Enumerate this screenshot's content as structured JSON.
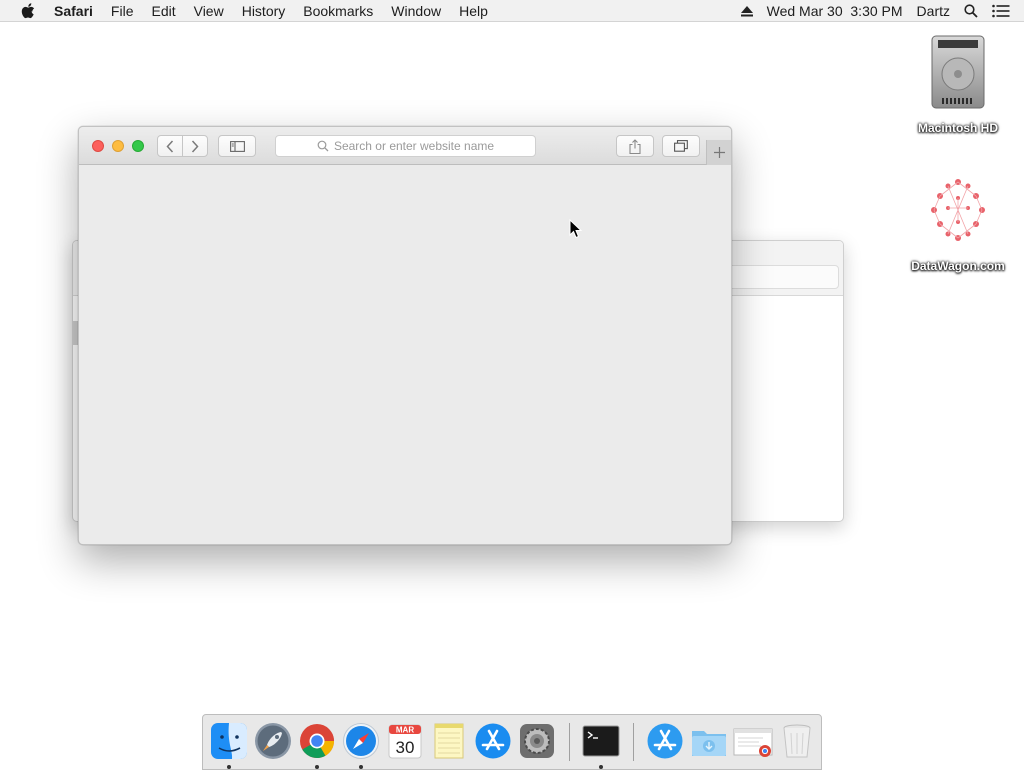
{
  "menubar": {
    "app_name": "Safari",
    "items": [
      "File",
      "Edit",
      "View",
      "History",
      "Bookmarks",
      "Window",
      "Help"
    ],
    "datetime": "Wed Mar 30  3:30 PM",
    "user": "Dartz"
  },
  "desktop": {
    "icons": [
      {
        "label": "Macintosh HD"
      },
      {
        "label": "DataWagon.com"
      }
    ]
  },
  "safari": {
    "address_placeholder": "Search or enter website name"
  },
  "dock": {
    "calendar": {
      "month": "MAR",
      "day": "30"
    },
    "apps": [
      "Finder",
      "Launchpad",
      "Google Chrome",
      "Safari",
      "Calendar",
      "Notes",
      "App Store",
      "System Preferences",
      "Terminal",
      "App Store",
      "Downloads",
      "Document",
      "Trash"
    ]
  },
  "colors": {
    "close": "#fc605c",
    "minimize": "#fdbc40",
    "maximize": "#34c84a"
  }
}
